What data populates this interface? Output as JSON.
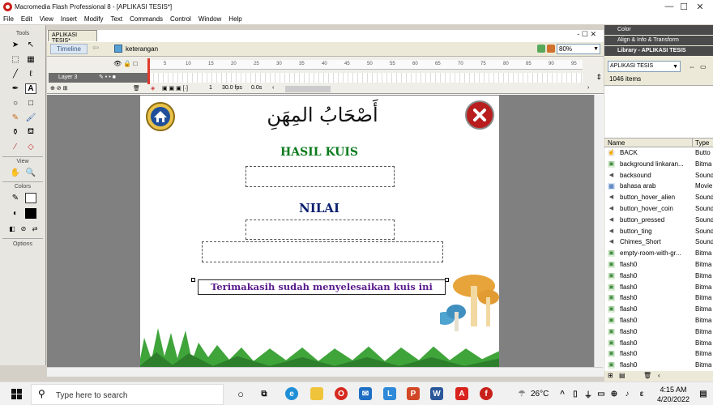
{
  "window": {
    "title": "Macromedia Flash Professional 8 - [APLIKASI TESIS*]",
    "minimize": "—",
    "restore": "☐",
    "close": "✕"
  },
  "menu": [
    "File",
    "Edit",
    "View",
    "Insert",
    "Modify",
    "Text",
    "Commands",
    "Control",
    "Window",
    "Help"
  ],
  "tools": {
    "title": "Tools",
    "view_title": "View",
    "colors_title": "Colors",
    "options_title": "Options"
  },
  "document": {
    "tab": "APLIKASI TESIS*",
    "controls": "- ☐ ✕",
    "timeline_button": "Timeline",
    "scene": "keterangan",
    "zoom": "80%"
  },
  "timeline": {
    "ticks": [
      "5",
      "10",
      "15",
      "20",
      "25",
      "30",
      "35",
      "40",
      "45",
      "50",
      "55",
      "60",
      "65",
      "70",
      "75",
      "80",
      "85",
      "90",
      "95"
    ],
    "layer_name": "Layer 3",
    "frame": "1",
    "fps": "30.0 fps",
    "time": "0.0s"
  },
  "stage": {
    "arabic_title": "أَصْحَابُ المِهَنِ",
    "result_heading": "HASIL KUIS",
    "score_heading": "NILAI",
    "thanks": "Terimakasih sudah menyelesaikan kuis ini"
  },
  "right_panel": {
    "color": "Color",
    "align": "Align & Info & Transform",
    "library_title": "Library - APLIKASI TESIS",
    "library_select": "APLIKASI TESIS",
    "item_count": "1046 items",
    "col_name": "Name",
    "col_type": "Type",
    "items": [
      {
        "name": "BACK",
        "type": "Butto",
        "icon": "button"
      },
      {
        "name": "background linkaran...",
        "type": "Bitma",
        "icon": "bitmap"
      },
      {
        "name": "backsound",
        "type": "Sound",
        "icon": "sound"
      },
      {
        "name": "bahasa arab",
        "type": "Movie",
        "icon": "movie"
      },
      {
        "name": "button_hover_alien",
        "type": "Sound",
        "icon": "sound"
      },
      {
        "name": "button_hover_coin",
        "type": "Sound",
        "icon": "sound"
      },
      {
        "name": "button_pressed",
        "type": "Sound",
        "icon": "sound"
      },
      {
        "name": "button_ting",
        "type": "Sound",
        "icon": "sound"
      },
      {
        "name": "Chimes_Short",
        "type": "Sound",
        "icon": "sound"
      },
      {
        "name": "empty-room-with-gr...",
        "type": "Bitma",
        "icon": "bitmap"
      },
      {
        "name": "flash0",
        "type": "Bitma",
        "icon": "bitmap"
      },
      {
        "name": "flash0",
        "type": "Bitma",
        "icon": "bitmap"
      },
      {
        "name": "flash0",
        "type": "Bitma",
        "icon": "bitmap"
      },
      {
        "name": "flash0",
        "type": "Bitma",
        "icon": "bitmap"
      },
      {
        "name": "flash0",
        "type": "Bitma",
        "icon": "bitmap"
      },
      {
        "name": "flash0",
        "type": "Bitma",
        "icon": "bitmap"
      },
      {
        "name": "flash0",
        "type": "Bitma",
        "icon": "bitmap"
      },
      {
        "name": "flash0",
        "type": "Bitma",
        "icon": "bitmap"
      },
      {
        "name": "flash0",
        "type": "Bitma",
        "icon": "bitmap"
      },
      {
        "name": "flash0",
        "type": "Bitma",
        "icon": "bitmap"
      }
    ]
  },
  "taskbar": {
    "search_placeholder": "Type here to search",
    "temperature": "26°C",
    "time": "4:15 AM",
    "date": "4/20/2022"
  },
  "colors": {
    "heading_green": "#0a7a1c",
    "heading_navy": "#0b1f6e",
    "thanks_purple": "#5a1a8c",
    "close_red": "#c8201a",
    "panel_dark": "#4a4a4a"
  }
}
